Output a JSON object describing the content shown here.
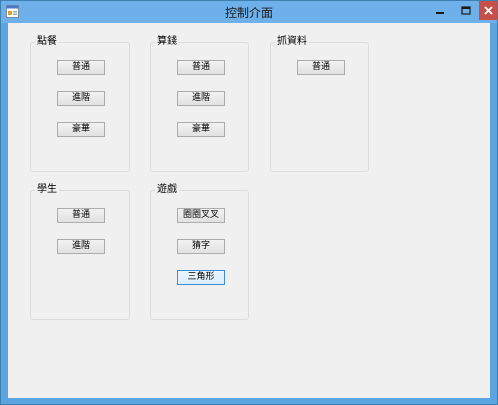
{
  "window": {
    "title": "控制介面",
    "icon": "app-form-icon",
    "controls": {
      "minimize": "minimize-icon",
      "maximize": "maximize-icon",
      "close": "close-icon"
    }
  },
  "groups": {
    "order_food": {
      "label": "點餐",
      "buttons": [
        "普通",
        "進階",
        "豪華"
      ]
    },
    "calculate": {
      "label": "算錢",
      "buttons": [
        "普通",
        "進階",
        "豪華"
      ]
    },
    "grab_data": {
      "label": "抓資料",
      "buttons": [
        "普通"
      ]
    },
    "student": {
      "label": "學生",
      "buttons": [
        "普通",
        "進階"
      ]
    },
    "game": {
      "label": "遊戲",
      "buttons": [
        "圈圈叉叉",
        "猜字",
        "三角形"
      ]
    }
  },
  "colors": {
    "titlebar": "#6eb0ea",
    "client": "#f0f0f0",
    "close_button": "#c74f49",
    "focus_border": "#3c8fd6"
  }
}
